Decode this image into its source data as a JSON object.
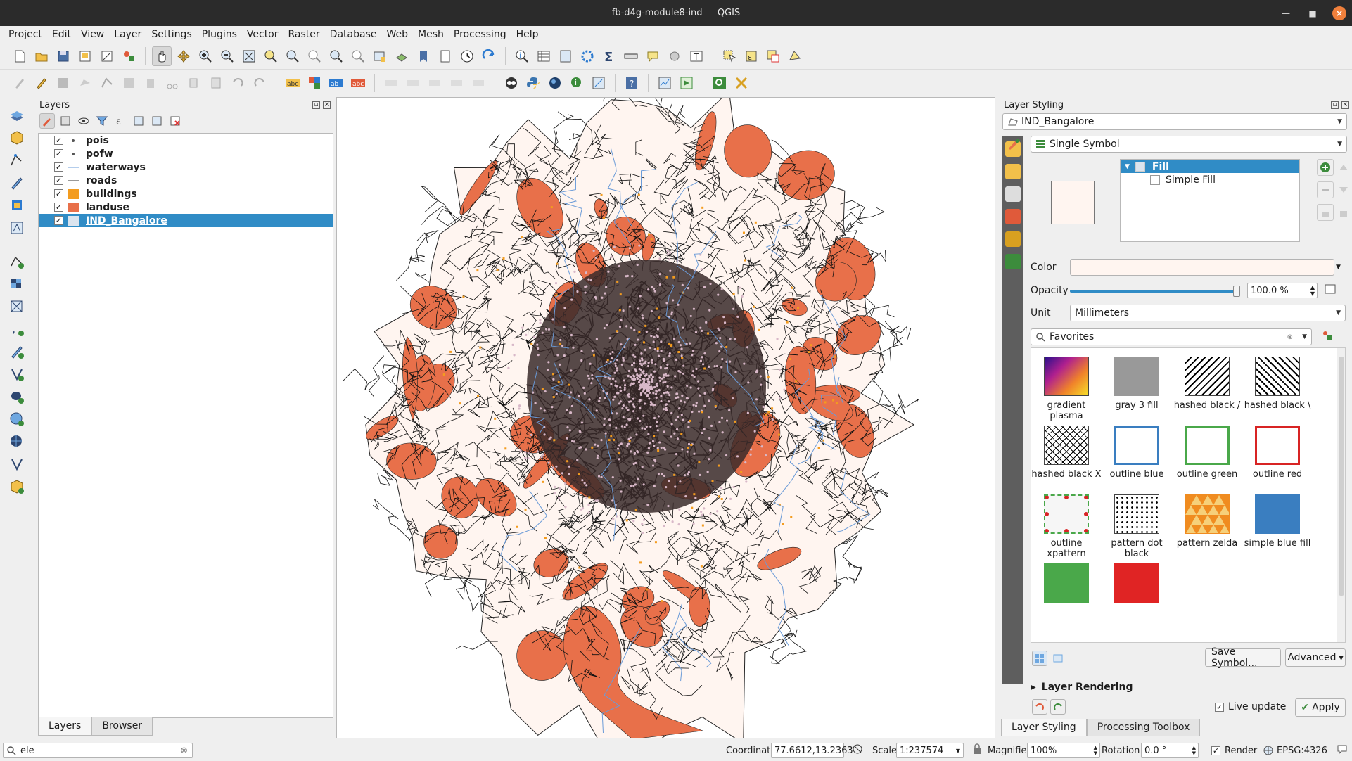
{
  "window": {
    "title": "fb-d4g-module8-ind — QGIS"
  },
  "menu": [
    "Project",
    "Edit",
    "View",
    "Layer",
    "Settings",
    "Plugins",
    "Vector",
    "Raster",
    "Database",
    "Web",
    "Mesh",
    "Processing",
    "Help"
  ],
  "layers_panel": {
    "title": "Layers",
    "layers": [
      {
        "name": "pois",
        "symbol": "dot",
        "checked": true
      },
      {
        "name": "pofw",
        "symbol": "dot",
        "checked": true
      },
      {
        "name": "waterways",
        "symbol": "line-blue",
        "checked": true
      },
      {
        "name": "roads",
        "symbol": "line-dark",
        "checked": true
      },
      {
        "name": "buildings",
        "symbol": "fill-orange",
        "checked": true
      },
      {
        "name": "landuse",
        "symbol": "fill-red",
        "checked": true
      },
      {
        "name": "IND_Bangalore",
        "symbol": "fill-light",
        "checked": true,
        "selected": true
      }
    ],
    "tabs": [
      "Layers",
      "Browser"
    ]
  },
  "styling": {
    "title": "Layer Styling",
    "layer": "IND_Bangalore",
    "renderer": "Single Symbol",
    "tree": {
      "fill": "Fill",
      "simple_fill": "Simple Fill"
    },
    "color_label": "Color",
    "fill_color": "#fff5f0",
    "opacity_label": "Opacity",
    "opacity_value": "100.0 %",
    "opacity": 1.0,
    "unit_label": "Unit",
    "unit_value": "Millimeters",
    "search": "Favorites",
    "symbols": [
      {
        "label": "gradient plasma"
      },
      {
        "label": "gray 3 fill"
      },
      {
        "label": "hashed black /"
      },
      {
        "label": "hashed black \\"
      },
      {
        "label": "hashed black X"
      },
      {
        "label": "outline blue"
      },
      {
        "label": "outline green"
      },
      {
        "label": "outline red"
      },
      {
        "label": "outline xpattern"
      },
      {
        "label": "pattern dot black"
      },
      {
        "label": "pattern zelda"
      },
      {
        "label": "simple blue fill"
      }
    ],
    "save_symbol": "Save Symbol...",
    "advanced": "Advanced",
    "layer_rendering": "Layer Rendering",
    "live_update": "Live update",
    "apply": "Apply",
    "tabs": [
      "Layer Styling",
      "Processing Toolbox"
    ]
  },
  "status": {
    "search_value": "ele",
    "coordinate_label": "Coordinate",
    "coordinate": "77.6612,13.2363",
    "scale_label": "Scale",
    "scale": "1:237574",
    "magnifier_label": "Magnifier",
    "magnifier": "100%",
    "rotation_label": "Rotation",
    "rotation": "0.0 °",
    "render_label": "Render",
    "crs": "EPSG:4326"
  },
  "colors": {
    "selection": "#308cc6",
    "landuse": "#e8704a",
    "buildings": "#f39c1f",
    "boundary_fill": "#fff5f0",
    "waterways": "#6a9bd8"
  }
}
